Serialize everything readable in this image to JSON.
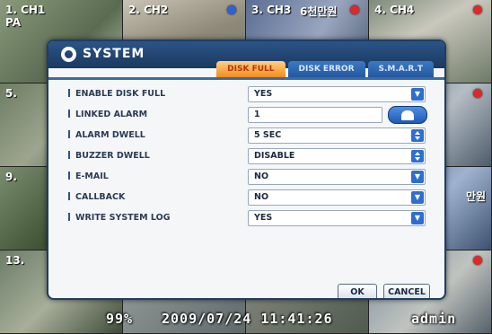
{
  "cameras": [
    {
      "label": "1. CH1",
      "sub": "PA"
    },
    {
      "label": "2. CH2",
      "sub": ""
    },
    {
      "label": "3. CH3",
      "sub": "6천만원"
    },
    {
      "label": "4. CH4",
      "sub": ""
    },
    {
      "label": "5.",
      "sub": ""
    },
    {
      "label": "",
      "sub": ""
    },
    {
      "label": "",
      "sub": ""
    },
    {
      "label": "",
      "sub": ""
    },
    {
      "label": "9.",
      "sub": ""
    },
    {
      "label": "",
      "sub": ""
    },
    {
      "label": "",
      "sub": ""
    },
    {
      "label": "",
      "sub": "만원"
    },
    {
      "label": "13.",
      "sub": ""
    },
    {
      "label": "",
      "sub": ""
    },
    {
      "label": "",
      "sub": ""
    },
    {
      "label": "",
      "sub": ""
    }
  ],
  "status": {
    "hdd": "99%",
    "clock": "2009/07/24 11:41:26",
    "user": "admin"
  },
  "dialog": {
    "title": "SYSTEM",
    "tabs": [
      "DISK FULL",
      "DISK ERROR",
      "S.M.A.R.T"
    ],
    "active_tab": "DISK FULL",
    "rows": [
      {
        "label": "ENABLE DISK FULL",
        "value": "YES"
      },
      {
        "label": "LINKED ALARM",
        "value": "1"
      },
      {
        "label": "ALARM DWELL",
        "value": "5 SEC"
      },
      {
        "label": "BUZZER DWELL",
        "value": "DISABLE"
      },
      {
        "label": "E-MAIL",
        "value": "NO"
      },
      {
        "label": "CALLBACK",
        "value": "NO"
      },
      {
        "label": "WRITE SYSTEM LOG",
        "value": "YES"
      }
    ],
    "ok_label": "OK",
    "cancel_label": "CANCEL"
  },
  "colors": {
    "title_bar": "#1d3e66",
    "active_tab": "#f28c1a",
    "inactive_tab": "#2457a0",
    "control_blue": "#2d6fd0",
    "record_dot": "#e02828"
  },
  "icons": {
    "title": "gear-icon",
    "dropdown": "chevron-down-icon",
    "spinner": "spinner-arrows-icon",
    "alarm": "alarm-bell-icon",
    "record": "record-dot-icon"
  }
}
